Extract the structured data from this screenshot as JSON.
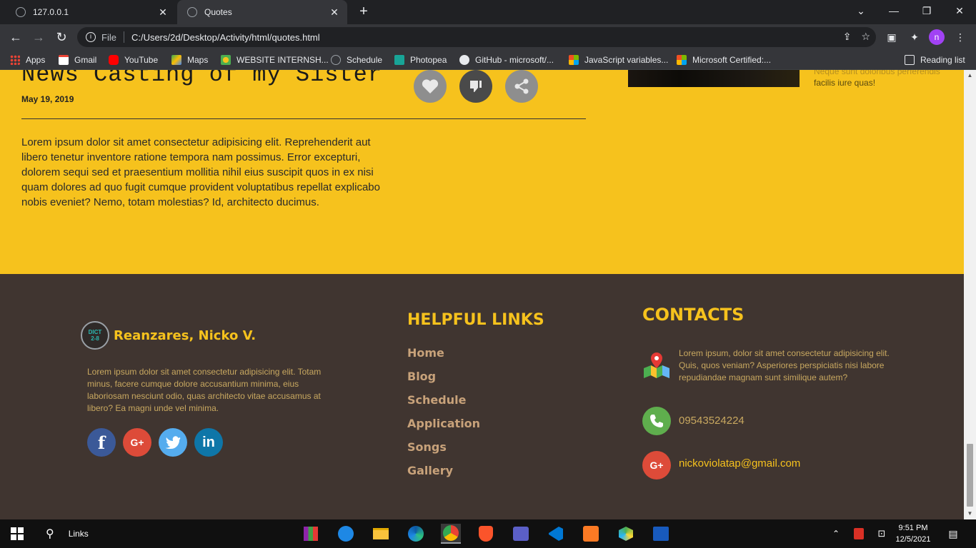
{
  "browser": {
    "tabs": [
      {
        "title": "127.0.0.1",
        "active": false
      },
      {
        "title": "Quotes",
        "active": true
      }
    ],
    "address": {
      "scheme_label": "File",
      "url": "C:/Users/2d/Desktop/Activity/html/quotes.html"
    },
    "profile_initial": "n",
    "bookmarks": [
      {
        "label": "Apps",
        "icon": "apps-grid-icon"
      },
      {
        "label": "Gmail",
        "icon": "gmail-icon"
      },
      {
        "label": "YouTube",
        "icon": "youtube-icon"
      },
      {
        "label": "Maps",
        "icon": "maps-icon"
      },
      {
        "label": "WEBSITE INTERNSH...",
        "icon": "website-icon"
      },
      {
        "label": "Schedule",
        "icon": "globe-icon"
      },
      {
        "label": "Photopea",
        "icon": "photopea-icon"
      },
      {
        "label": "GitHub - microsoft/...",
        "icon": "github-icon"
      },
      {
        "label": "JavaScript variables...",
        "icon": "microsoft-icon"
      },
      {
        "label": "Microsoft Certified:...",
        "icon": "microsoft-icon"
      }
    ],
    "reading_list": "Reading list"
  },
  "post": {
    "title": "News Casting of my Sister",
    "date": "May 19, 2019",
    "body": "Lorem ipsum dolor sit amet consectetur adipisicing elit. Reprehenderit aut libero tenetur inventore ratione tempora nam possimus. Error excepturi, dolorem sequi sed et praesentium mollitia nihil eius suscipit quos in ex nisi quam dolores ad quo fugit cumque provident voluptatibus repellat explicabo nobis eveniet? Nemo, totam molestias? Id, architecto ducimus.",
    "side_text_line1": "Neque sunt doloribus perferendis",
    "side_text_line2": "facilis iure quas!"
  },
  "footer": {
    "brand_logo_line1": "DICT",
    "brand_logo_line2": "2-8",
    "brand_name": "Reanzares, Nicko V.",
    "brand_description": "Lorem ipsum dolor sit amet consectetur adipisicing elit. Totam minus, facere cumque dolore accusantium minima, eius laboriosam nesciunt odio, quas architecto vitae accusamus at libero? Ea magni unde vel minima.",
    "social": [
      {
        "label": "f",
        "icon": "facebook-icon",
        "color": "#3b5998"
      },
      {
        "label": "G+",
        "icon": "google-plus-icon",
        "color": "#dd4b39"
      },
      {
        "label": "t",
        "icon": "twitter-icon",
        "color": "#55acee"
      },
      {
        "label": "in",
        "icon": "linkedin-icon",
        "color": "#0e76a8"
      }
    ],
    "links_title": "HELPFUL LINKS",
    "links": [
      "Home",
      "Blog",
      "Schedule",
      "Application",
      "Songs",
      "Gallery"
    ],
    "contacts_title": "CONTACTS",
    "address_text": "Lorem ipsum, dolor sit amet consectetur adipisicing elit. Quis, quos veniam? Asperiores perspiciatis nisi labore repudiandae magnam sunt similique autem?",
    "phone": "09543524224",
    "email": "nickoviolatap@gmail.com"
  },
  "taskbar": {
    "search_label": "Links",
    "time": "9:51 PM",
    "date": "12/5/2021"
  },
  "colors": {
    "accent_yellow": "#f6c21d",
    "footer_brown": "#403530",
    "link_tan": "#c8a27a"
  }
}
